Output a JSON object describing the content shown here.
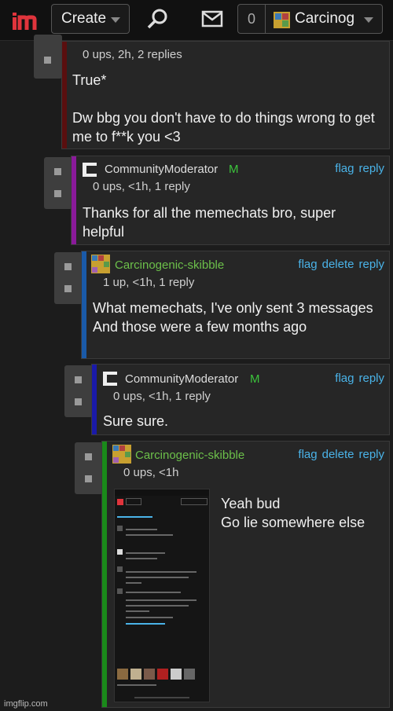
{
  "topbar": {
    "logo": "im",
    "create_label": "Create",
    "notif_count": "0",
    "username": "Carcinog",
    "icons": [
      "search-icon",
      "mail-icon",
      "chevron-down-icon"
    ]
  },
  "comments": [
    {
      "meta": "0 ups, 2h, 2 replies",
      "body": "True*\n\nDw bbg you don't have to do things wrong to get me to f**k you <3",
      "bar_color": "#5a0f0f"
    },
    {
      "username": "CommunityModerator",
      "badge": "M",
      "meta": "0 ups, <1h, 1 reply",
      "body": "Thanks for all the memechats bro, super helpful",
      "flag": "flag",
      "reply": "reply",
      "bar_color": "#8a1a9a"
    },
    {
      "username": "Carcinogenic-skibble",
      "meta": "1 up, <1h, 1 reply",
      "body": "What memechats, I've only sent 3 messages\nAnd those were a few months ago",
      "flag": "flag",
      "delete": "delete",
      "reply": "reply",
      "bar_color": "#1a5aa8"
    },
    {
      "username": "CommunityModerator",
      "badge": "M",
      "meta": "0 ups, <1h, 1 reply",
      "body": "Sure sure.",
      "flag": "flag",
      "reply": "reply",
      "bar_color": "#1a1aa8"
    },
    {
      "username": "Carcinogenic-skibble",
      "meta": "0 ups, <1h",
      "body": "Yeah bud\nGo lie somewhere else",
      "flag": "flag",
      "delete": "delete",
      "reply": "reply",
      "bar_color": "#1a8a1a"
    }
  ],
  "watermark": "imgflip.com"
}
